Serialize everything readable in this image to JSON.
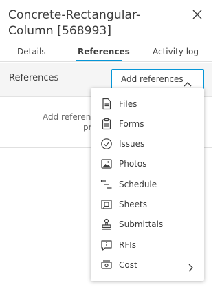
{
  "header": {
    "title": "Concrete-Rectangular-Column [568993]",
    "close_icon": "close-icon"
  },
  "tabs": [
    {
      "label": "Details",
      "active": false
    },
    {
      "label": "References",
      "active": true
    },
    {
      "label": "Activity log",
      "active": false
    }
  ],
  "references": {
    "label": "References",
    "add_button_label": "Add references",
    "empty_line1": "Add references",
    "empty_line2": "pr"
  },
  "menu": {
    "items": [
      {
        "label": "Files",
        "icon": "file-icon"
      },
      {
        "label": "Forms",
        "icon": "clipboard-icon"
      },
      {
        "label": "Issues",
        "icon": "check-circle-icon"
      },
      {
        "label": "Photos",
        "icon": "photo-icon"
      },
      {
        "label": "Schedule",
        "icon": "schedule-icon"
      },
      {
        "label": "Sheets",
        "icon": "sheet-icon"
      },
      {
        "label": "Submittals",
        "icon": "stamp-icon"
      },
      {
        "label": "RFIs",
        "icon": "rfi-icon"
      },
      {
        "label": "Cost",
        "icon": "cost-icon",
        "has_submenu": true
      }
    ]
  },
  "colors": {
    "accent": "#0696d7",
    "text": "#3c3c3c",
    "bar_background": "#f5f5f5"
  }
}
